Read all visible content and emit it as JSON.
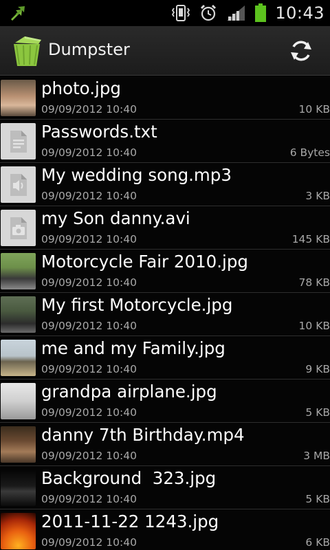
{
  "status_bar": {
    "time": "10:43",
    "icons": [
      "sync-arrows-icon",
      "vibrate-icon",
      "alarm-icon",
      "signal-icon",
      "battery-icon"
    ]
  },
  "action_bar": {
    "title": "Dumpster",
    "app_icon": "dumpster-bin-icon",
    "refresh_icon": "refresh-icon"
  },
  "files": [
    {
      "name": "photo.jpg",
      "date": "09/09/2012 10:40",
      "size": "10 KB",
      "thumb": "photo-person"
    },
    {
      "name": "Passwords.txt",
      "date": "09/09/2012 10:40",
      "size": "6 Bytes",
      "thumb": "document-icon"
    },
    {
      "name": "My wedding song.mp3",
      "date": "09/09/2012 10:40",
      "size": "3 KB",
      "thumb": "speaker-icon"
    },
    {
      "name": "my Son danny.avi",
      "date": "09/09/2012 10:40",
      "size": "145 KB",
      "thumb": "camera-icon"
    },
    {
      "name": "Motorcycle Fair 2010.jpg",
      "date": "09/09/2012 10:40",
      "size": "78 KB",
      "thumb": "photo-moto1"
    },
    {
      "name": "My first Motorcycle.jpg",
      "date": "09/09/2012 10:40",
      "size": "10 KB",
      "thumb": "photo-moto2"
    },
    {
      "name": "me and my Family.jpg",
      "date": "09/09/2012 10:40",
      "size": "9 KB",
      "thumb": "photo-family"
    },
    {
      "name": "grandpa airplane.jpg",
      "date": "09/09/2012 10:40",
      "size": "5 KB",
      "thumb": "photo-plane"
    },
    {
      "name": "danny 7th Birthday.mp4",
      "date": "09/09/2012 10:40",
      "size": "3 MB",
      "thumb": "photo-danny"
    },
    {
      "name": "Background  323.jpg",
      "date": "09/09/2012 10:40",
      "size": "5 KB",
      "thumb": "photo-bg"
    },
    {
      "name": "2011-11-22 1243.jpg",
      "date": "09/09/2012 10:40",
      "size": "6 KB",
      "thumb": "photo-sun"
    }
  ],
  "colors": {
    "battery": "#5cc21e",
    "bin_green": "#8cc63f",
    "text_secondary": "#a8a8a8"
  }
}
